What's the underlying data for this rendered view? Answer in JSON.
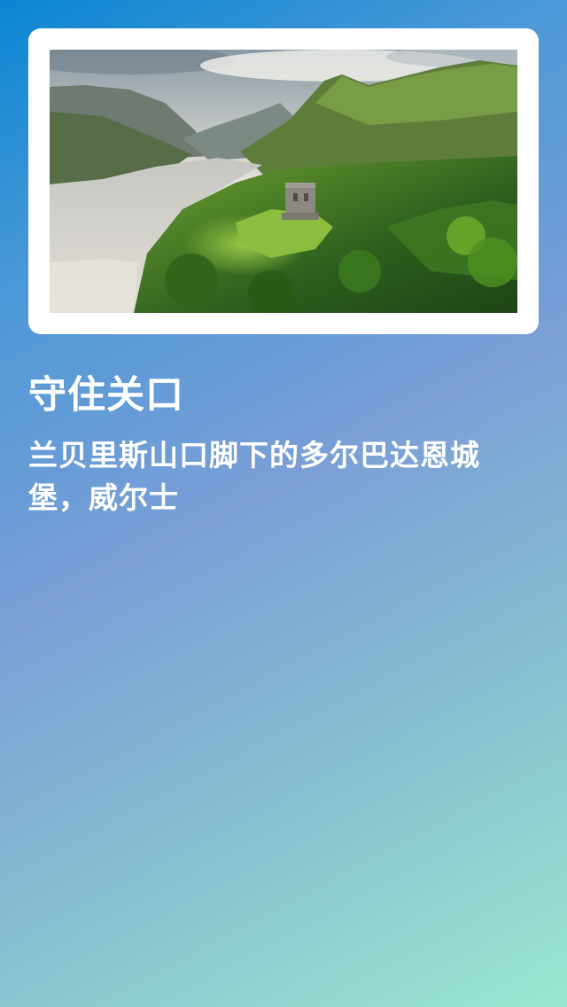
{
  "story": {
    "title": "守住关口",
    "caption": "兰贝里斯山口脚下的多尔巴达恩城堡，威尔士"
  },
  "colors": {
    "background_start": "#0a86d2",
    "background_mid": "#7b9fd6",
    "background_end": "#9be6d0",
    "card": "#ffffff",
    "text": "#ffffff"
  }
}
